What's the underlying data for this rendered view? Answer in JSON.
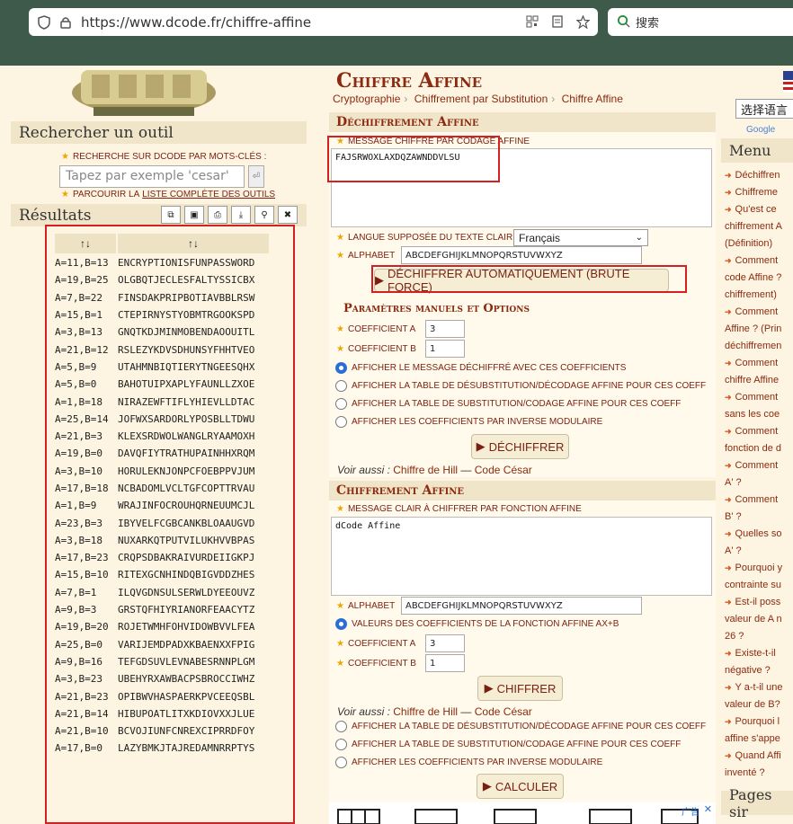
{
  "browser": {
    "url": "https://www.dcode.fr/chiffre-affine",
    "search_placeholder": "搜索"
  },
  "left": {
    "search_title": "Rechercher un outil",
    "search_label": "RECHERCHE SUR DCODE PAR MOTS-CLÉS :",
    "search_placeholder": "Tapez par exemple 'cesar'",
    "browse_prefix": "PARCOURIR LA",
    "browse_link": "LISTE COMPLÈTE DES OUTILS",
    "results_title": "Résultats",
    "results_header": [
      "↑↓",
      "↑↓"
    ],
    "results": [
      [
        "A=11,B=13",
        "ENCRYPTIONISFUNPASSWORD"
      ],
      [
        "A=19,B=25",
        "OLGBQTJECLESFALTYSSICBX"
      ],
      [
        "A=7,B=22",
        "FINSDAKPRIPBOTIAVBBLRSW"
      ],
      [
        "A=15,B=1",
        "CTEPIRNYSTYOBMTRGOOKSPD"
      ],
      [
        "A=3,B=13",
        "GNQTKDJMINMOBENDAOOUITL"
      ],
      [
        "A=21,B=12",
        "RSLEZYKDVSDHUNSYFHHTVEO"
      ],
      [
        "A=5,B=9",
        "UTAHMNBIQTIERYTNGEESQHX"
      ],
      [
        "A=5,B=0",
        "BAHOTUIPXAPLYFAUNLLZXOE"
      ],
      [
        "A=1,B=18",
        "NIRAZEWFTIFLYHIEVLLDTAC"
      ],
      [
        "A=25,B=14",
        "JOFWXSARDORLYPOSBLLTDWU"
      ],
      [
        "A=21,B=3",
        "KLEXSRDWOLWANGLRYAAMOXH"
      ],
      [
        "A=19,B=0",
        "DAVQFIYTRATHUPAINHHXRQM"
      ],
      [
        "A=3,B=10",
        "HORULEKNJONPCFOEBPPVJUM"
      ],
      [
        "A=17,B=18",
        "NCBADOMLVCLTGFCOPTTRVAU"
      ],
      [
        "A=1,B=9",
        "WRAJINFOCROUHQRNEUUMCJL"
      ],
      [
        "A=23,B=3",
        "IBYVELFCGBCANKBLOAAUGVD"
      ],
      [
        "A=3,B=18",
        "NUXARKQTPUTVILUKHVVBPAS"
      ],
      [
        "A=17,B=23",
        "CRQPSDBAKRAIVURDEIIGKPJ"
      ],
      [
        "A=15,B=10",
        "RITEXGCNHINDQBIGVDDZHES"
      ],
      [
        "A=7,B=1",
        "ILQVGDNSULSERWLDYEEOUVZ"
      ],
      [
        "A=9,B=3",
        "GRSTQFHIYRIANORFEAACYTZ"
      ],
      [
        "A=19,B=20",
        "ROJETWMHFOHVIDOWBVVLFEA"
      ],
      [
        "A=25,B=0",
        "VARIJEMDPADXKBAENXXFPIG"
      ],
      [
        "A=9,B=16",
        "TEFGDSUVLEVNABESRNNPLGM"
      ],
      [
        "A=3,B=23",
        "UBEHYRXAWBACPSBROCCIWHZ"
      ],
      [
        "A=21,B=23",
        "OPIBWVHASPAERKPVCEEQSBL"
      ],
      [
        "A=21,B=14",
        "HIBUPOATLITXKDIOVXXJLUE"
      ],
      [
        "A=21,B=10",
        "BCVOJIUNFCNREXCIPRRDFOY"
      ],
      [
        "A=17,B=0",
        "LAZYBMKJTAJREDAMNRRPTYS"
      ]
    ]
  },
  "main": {
    "title": "Chiffre Affine",
    "breadcrumbs": [
      "Cryptographie",
      "Chiffrement par Substitution",
      "Chiffre Affine"
    ],
    "decrypt": {
      "heading": "Déchiffrement Affine",
      "message_label": "MESSAGE CHIFFRÉ PAR CODAGE AFFINE",
      "message_value": "FAJSRWOXLAXDQZAWNDDVLSU",
      "lang_label": "LANGUE SUPPOSÉE DU TEXTE CLAIR",
      "lang_value": "Français",
      "alphabet_label": "ALPHABET",
      "alphabet_value": "ABCDEFGHIJKLMNOPQRSTUVWXYZ",
      "brute_button": "DÉCHIFFRER AUTOMATIQUEMENT (BRUTE FORCE)",
      "manual_heading": "Paramètres manuels et Options",
      "coef_a_label": "COEFFICIENT A",
      "coef_a_value": "3",
      "coef_b_label": "COEFFICIENT B",
      "coef_b_value": "1",
      "options": [
        "AFFICHER LE MESSAGE DÉCHIFFRÉ AVEC CES COEFFICIENTS",
        "AFFICHER LA TABLE DE DÉSUBSTITUTION/DÉCODAGE AFFINE POUR CES COEFF",
        "AFFICHER LA TABLE DE SUBSTITUTION/CODAGE AFFINE POUR CES COEFF",
        "AFFICHER LES COEFFICIENTS PAR INVERSE MODULAIRE"
      ],
      "decrypt_button": "DÉCHIFFRER",
      "see_also": "Voir aussi :",
      "see_links": [
        "Chiffre de Hill",
        "Code César"
      ]
    },
    "encrypt": {
      "heading": "Chiffrement Affine",
      "message_label": "MESSAGE CLAIR À CHIFFRER PAR FONCTION AFFINE",
      "message_value": "dCode Affine",
      "alphabet_label": "ALPHABET",
      "alphabet_value": "ABCDEFGHIJKLMNOPQRSTUVWXYZ",
      "function_option": "VALEURS DES COEFFICIENTS DE LA FONCTION AFFINE AX+B",
      "coef_a_label": "COEFFICIENT A",
      "coef_a_value": "3",
      "coef_b_label": "COEFFICIENT B",
      "coef_b_value": "1",
      "encrypt_button": "CHIFFRER",
      "see_also": "Voir aussi :",
      "see_links": [
        "Chiffre de Hill",
        "Code César"
      ],
      "options": [
        "AFFICHER LA TABLE DE DÉSUBSTITUTION/DÉCODAGE AFFINE POUR CES COEFF",
        "AFFICHER LA TABLE DE SUBSTITUTION/CODAGE AFFINE POUR CES COEFF",
        "AFFICHER LES COEFFICIENTS PAR INVERSE MODULAIRE"
      ],
      "calc_button": "CALCULER"
    }
  },
  "right": {
    "lang_button": "选择语言",
    "google": "Google",
    "menu_title": "Menu",
    "menu_items": [
      "Déchiffren",
      "Chiffreme",
      "Qu'est ce",
      "chiffrement A",
      "(Définition)",
      "Comment",
      "code Affine ?",
      "chiffrement)",
      "Comment",
      "Affine ? (Prin",
      "déchiffremen",
      "Comment",
      "chiffre Affine",
      "Comment",
      "sans les coe",
      "Comment",
      "fonction de d",
      "Comment",
      "A' ?",
      "Comment",
      "B' ?",
      "Quelles so",
      "A' ?",
      "Pourquoi y",
      "contrainte su",
      "Est-il poss",
      "valeur de A n",
      "26 ?",
      "Existe-t-il",
      "négative ?",
      "Y a-t-il une",
      "valeur de B?",
      "Pourquoi l",
      "affine s'appe",
      "Quand Affi",
      "inventé ?"
    ],
    "pages_title": "Pages sir"
  },
  "ad": {
    "label": "广告"
  }
}
